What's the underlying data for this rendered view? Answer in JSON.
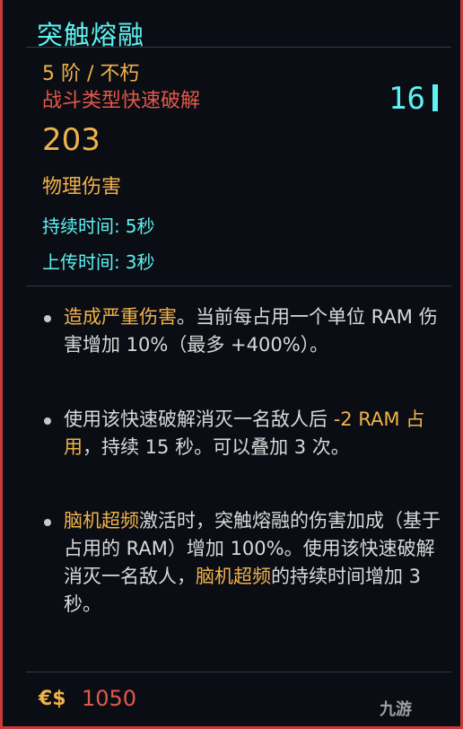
{
  "item": {
    "title": "突触熔融",
    "tier": "5 阶 / 不朽",
    "type": "战斗类型快速破解",
    "ram_cost": "16",
    "damage": "203",
    "damage_type": "物理伤害"
  },
  "stats": [
    {
      "label": "持续时间:",
      "value": "5秒"
    },
    {
      "label": "上传时间:",
      "value": "3秒"
    }
  ],
  "effects": {
    "e1": {
      "p1": "造成严重伤害",
      "p2": "。当前每占用一个单位 RAM 伤害增加 10%（最多 +400%）。"
    },
    "e2": {
      "p1": "使用该快速破解消灭一名敌人后 ",
      "p2": "-2 RAM 占用",
      "p3": "，持续 15 秒。可以叠加 3 次。"
    },
    "e3": {
      "p1": "脑机超频",
      "p2": "激活时，突触熔融的伤害加成（基于占用的 RAM）增加 100%。使用该快速破解消灭一名敌人，",
      "p3": "脑机超频",
      "p4": "的持续时间增加 3 秒。"
    }
  },
  "price": {
    "icon": "eurodollar-icon",
    "symbol": "€$",
    "value": "1050"
  },
  "watermark": "九游",
  "colors": {
    "accent_cyan": "#5ef2f2",
    "accent_orange": "#f0b24a",
    "accent_red": "#e2584a",
    "frame_red": "#c93a3a"
  }
}
